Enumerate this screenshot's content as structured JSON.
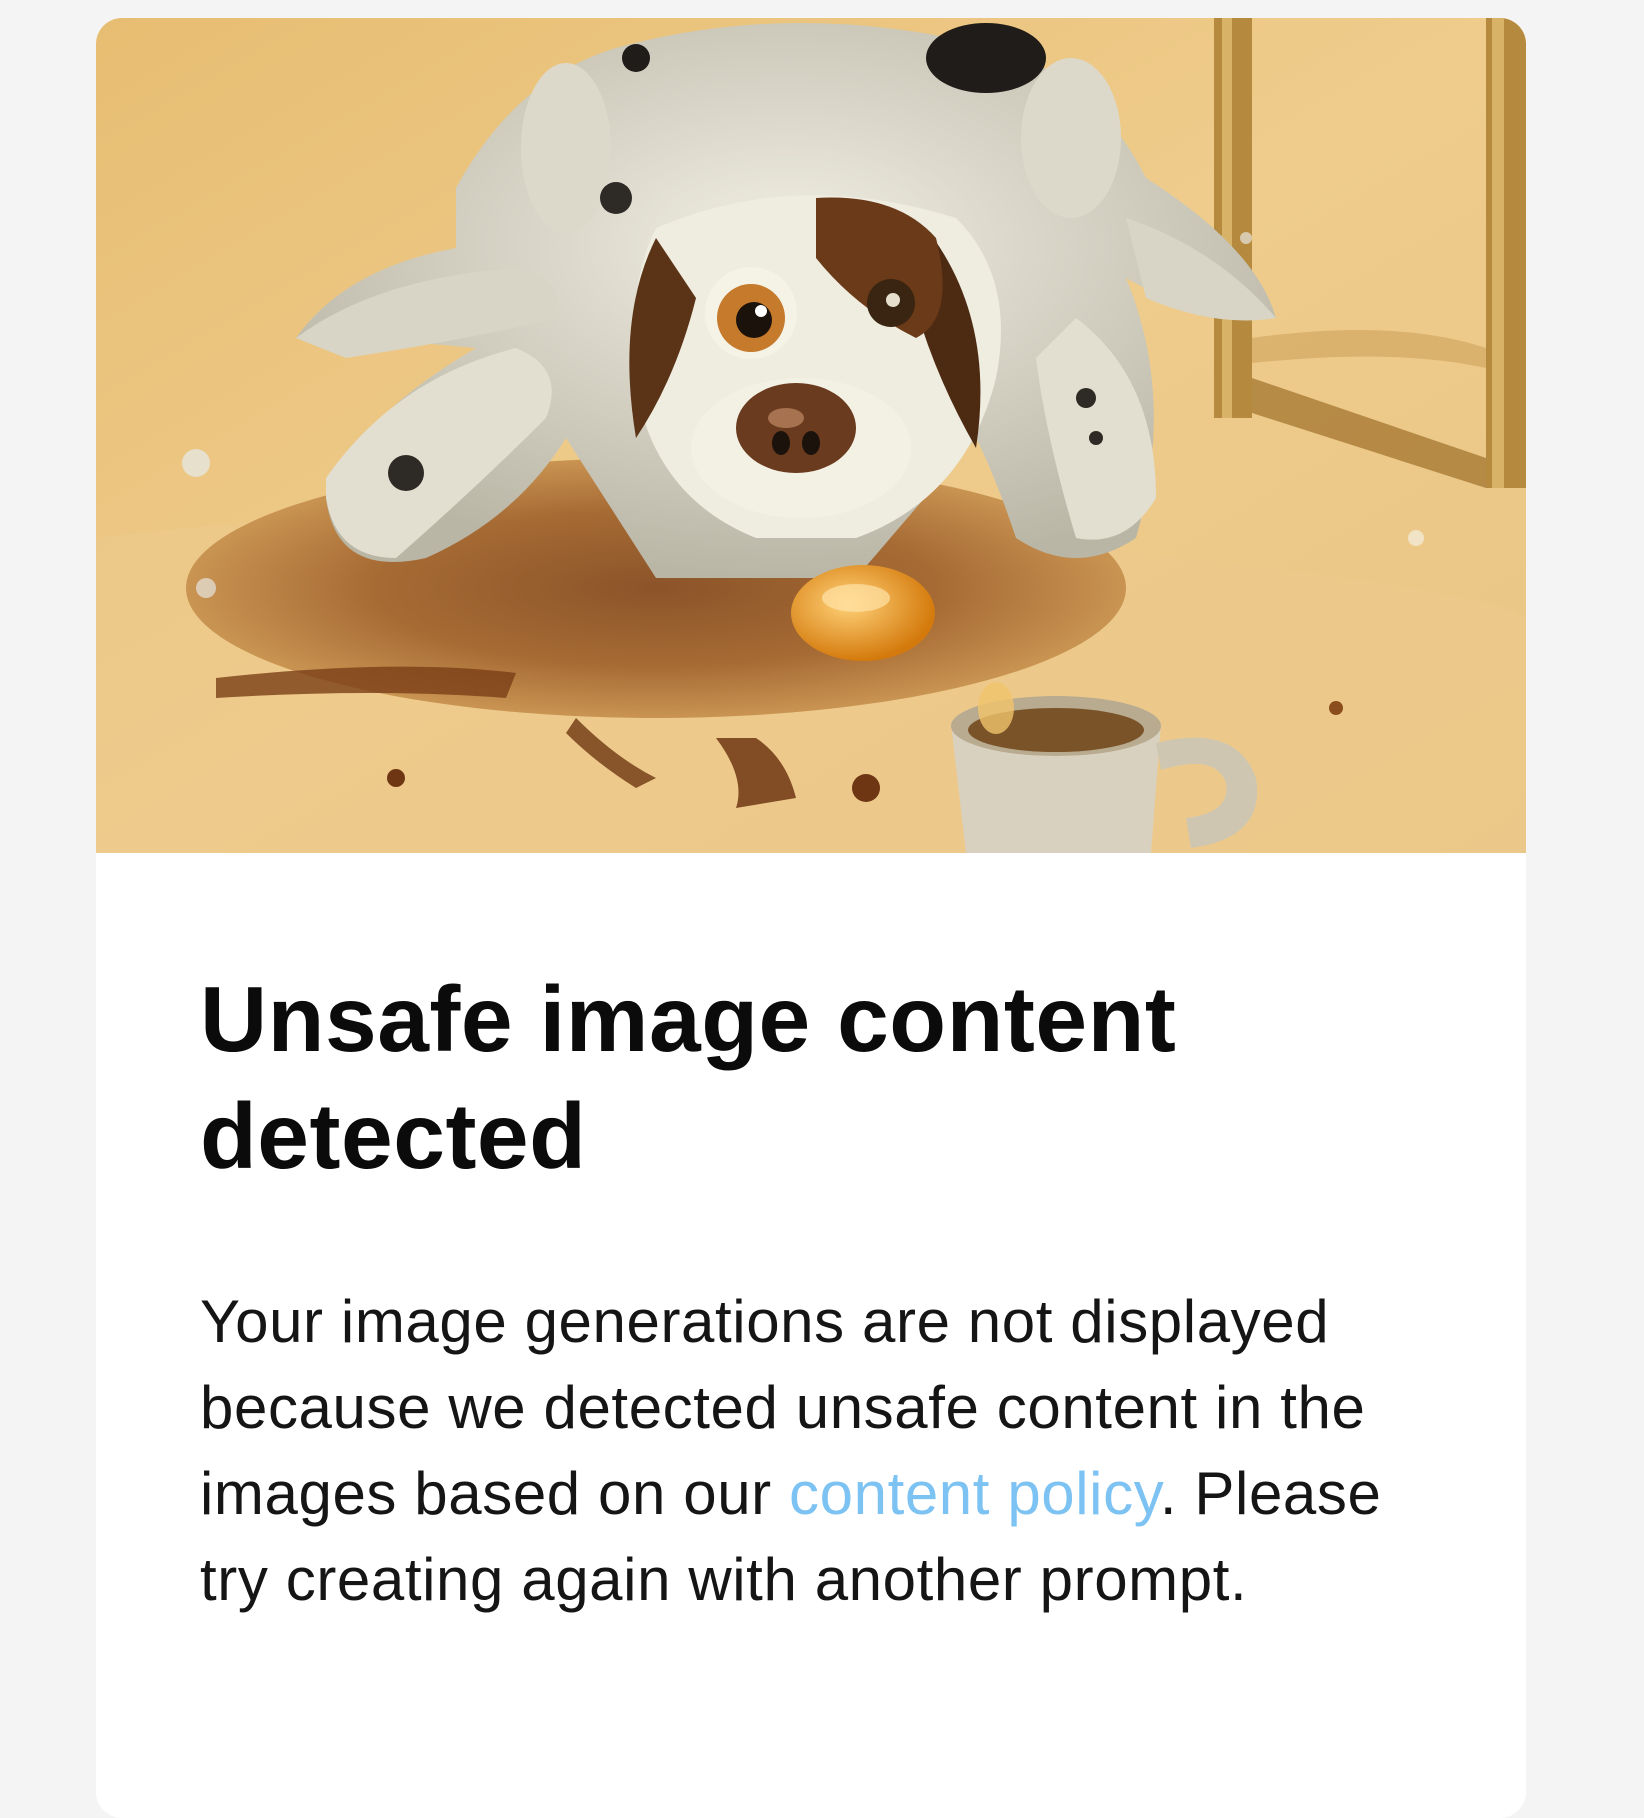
{
  "card": {
    "image_alt": "",
    "title": "Unsafe image content detected",
    "message": {
      "before_link": "Your image generations are not displayed because we detected unsafe content in the images based on our ",
      "link_label": "content policy",
      "after_link": ". Please try creating again with another prompt."
    }
  },
  "colors": {
    "page_background": "#f4f4f4",
    "card_background": "#ffffff",
    "link": "#7cc2f2",
    "title_text": "#0b0b0b",
    "body_text": "#151515"
  }
}
